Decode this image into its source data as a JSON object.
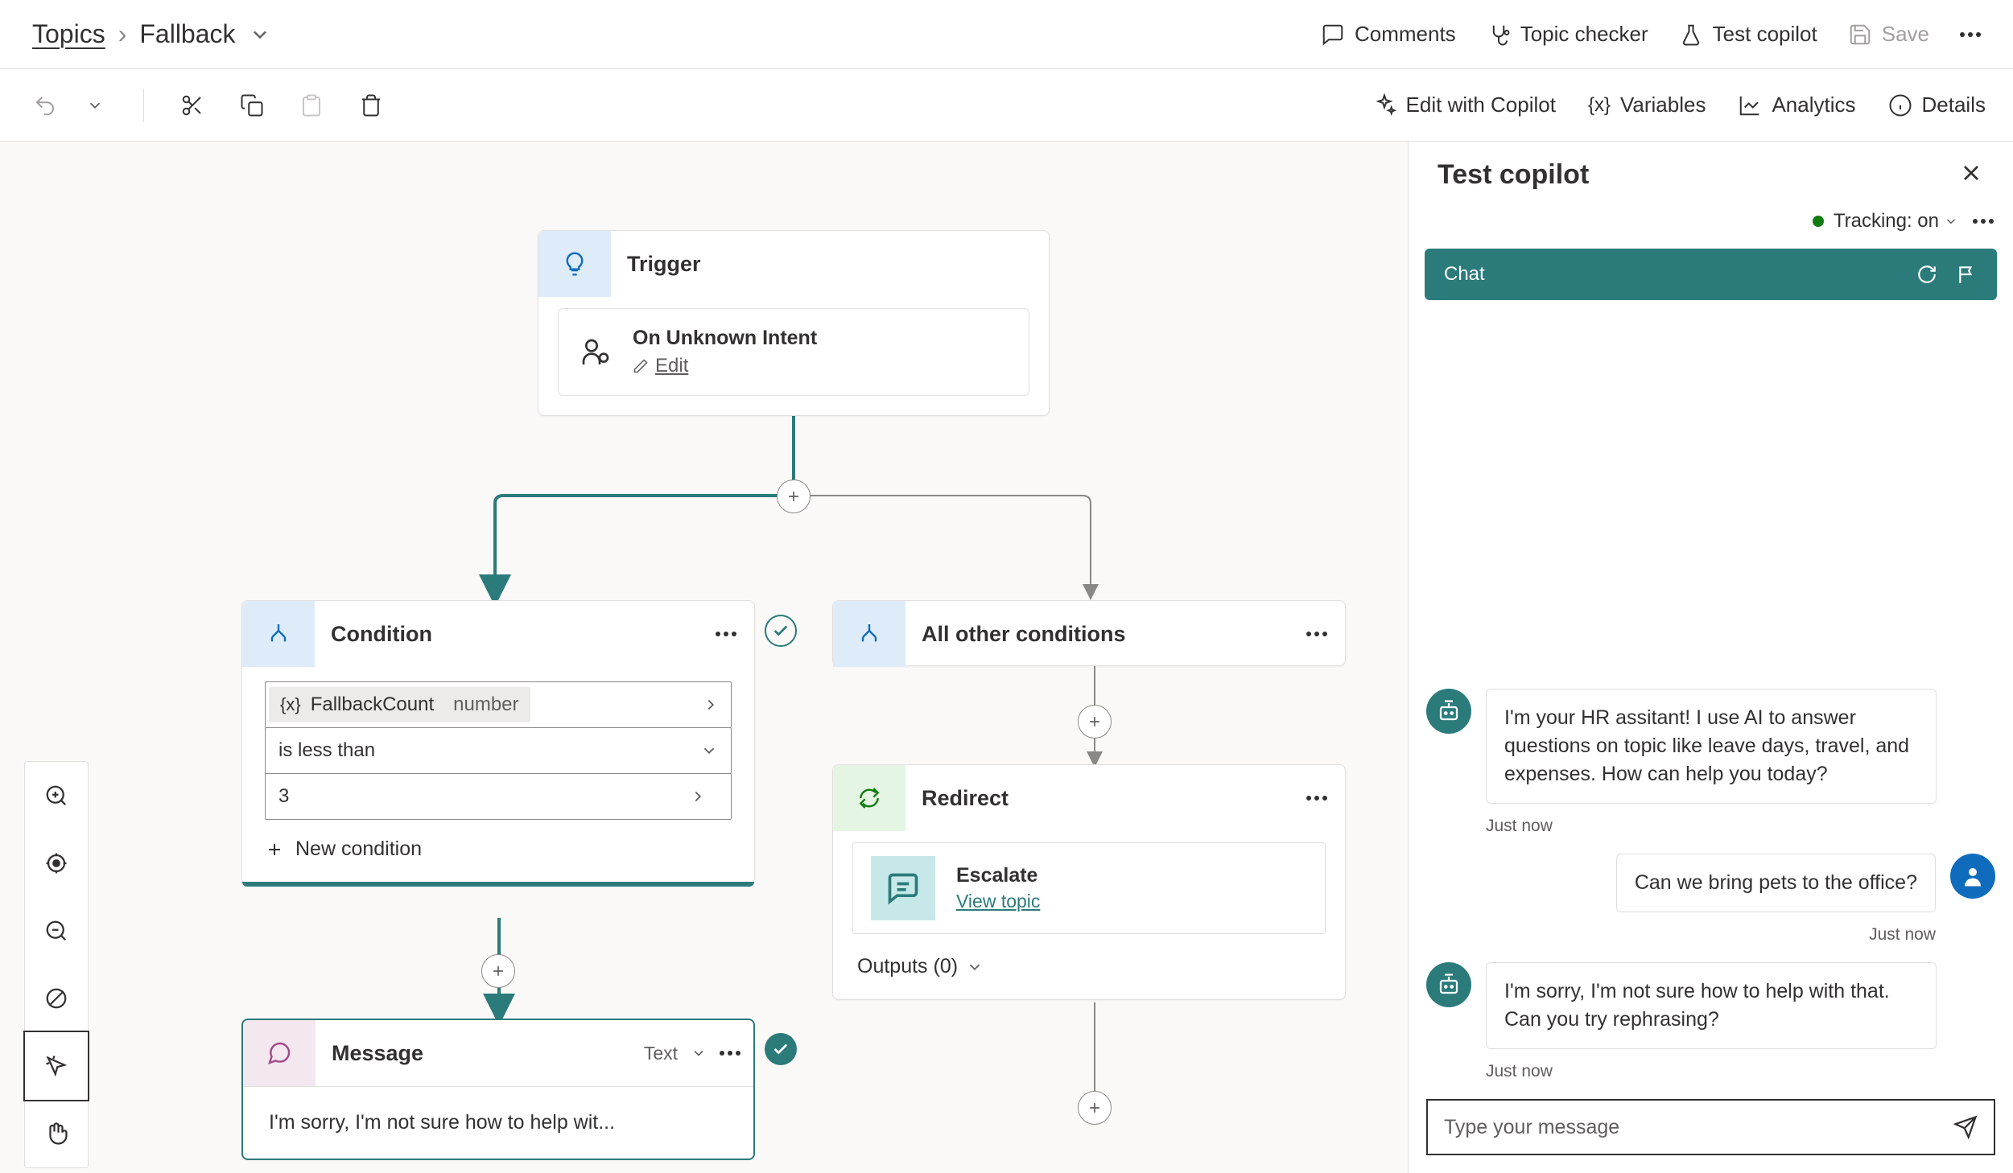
{
  "breadcrumb": {
    "root": "Topics",
    "current": "Fallback"
  },
  "toolbar1": {
    "comments": "Comments",
    "topic_checker": "Topic checker",
    "test_copilot": "Test copilot",
    "save": "Save"
  },
  "toolbar2": {
    "edit_with_copilot": "Edit with Copilot",
    "variables": "Variables",
    "analytics": "Analytics",
    "details": "Details"
  },
  "nodes": {
    "trigger": {
      "title": "Trigger",
      "intent_label": "On Unknown Intent",
      "edit": "Edit"
    },
    "condition": {
      "title": "Condition",
      "variable": "FallbackCount",
      "var_type": "number",
      "operator": "is less than",
      "value": "3",
      "new_condition": "New condition"
    },
    "all_other": {
      "title": "All other conditions"
    },
    "redirect": {
      "title": "Redirect",
      "target": "Escalate",
      "view_topic": "View topic",
      "outputs_label": "Outputs (0)"
    },
    "message": {
      "title": "Message",
      "format": "Text",
      "preview": "I'm sorry, I'm not sure how to help wit..."
    }
  },
  "test_pane": {
    "title": "Test copilot",
    "tracking": "Tracking: on",
    "chat_label": "Chat",
    "messages": {
      "bot1": "I'm your HR assitant! I use AI to answer questions on topic like leave days, travel, and expenses. How can help you today?",
      "bot1_ts": "Just now",
      "user1": "Can we bring pets to the office?",
      "user1_ts": "Just now",
      "bot2": "I'm sorry, I'm not sure how to help with that. Can you try rephrasing?",
      "bot2_ts": "Just now"
    },
    "input_placeholder": "Type your message"
  }
}
